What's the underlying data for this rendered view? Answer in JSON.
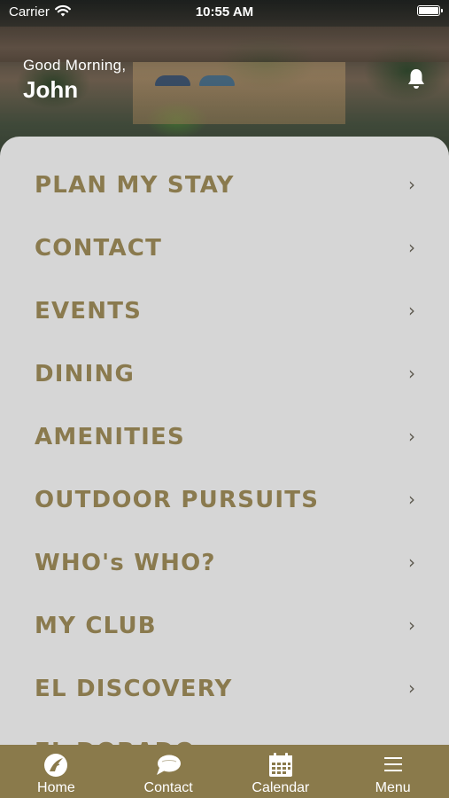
{
  "status_bar": {
    "carrier": "Carrier",
    "time": "10:55 AM",
    "wifi_icon": "wifi-icon",
    "battery_icon": "battery-icon"
  },
  "header": {
    "greeting": "Good Morning,",
    "user_name": "John",
    "notification_icon": "bell-icon"
  },
  "menu": {
    "items": [
      {
        "label": "PLAN MY STAY",
        "chevron": "›"
      },
      {
        "label": "CONTACT",
        "chevron": "›"
      },
      {
        "label": "EVENTS",
        "chevron": "›"
      },
      {
        "label": "DINING",
        "chevron": "›"
      },
      {
        "label": "AMENITIES",
        "chevron": "›"
      },
      {
        "label": "OUTDOOR PURSUITS",
        "chevron": "›"
      },
      {
        "label": "WHO's WHO?",
        "chevron": "›"
      },
      {
        "label": "MY CLUB",
        "chevron": "›"
      },
      {
        "label": "EL DISCOVERY",
        "chevron": "›"
      },
      {
        "label": "EL DORADO",
        "chevron": "›"
      }
    ]
  },
  "tab_bar": {
    "tabs": [
      {
        "label": "Home",
        "icon": "home-logo-icon"
      },
      {
        "label": "Contact",
        "icon": "chat-bubble-icon"
      },
      {
        "label": "Calendar",
        "icon": "calendar-icon"
      },
      {
        "label": "Menu",
        "icon": "hamburger-menu-icon"
      }
    ]
  },
  "colors": {
    "accent_gold": "#8a7a4b",
    "menu_text": "#8a7a4e",
    "card_background": "#d6d6d6"
  }
}
